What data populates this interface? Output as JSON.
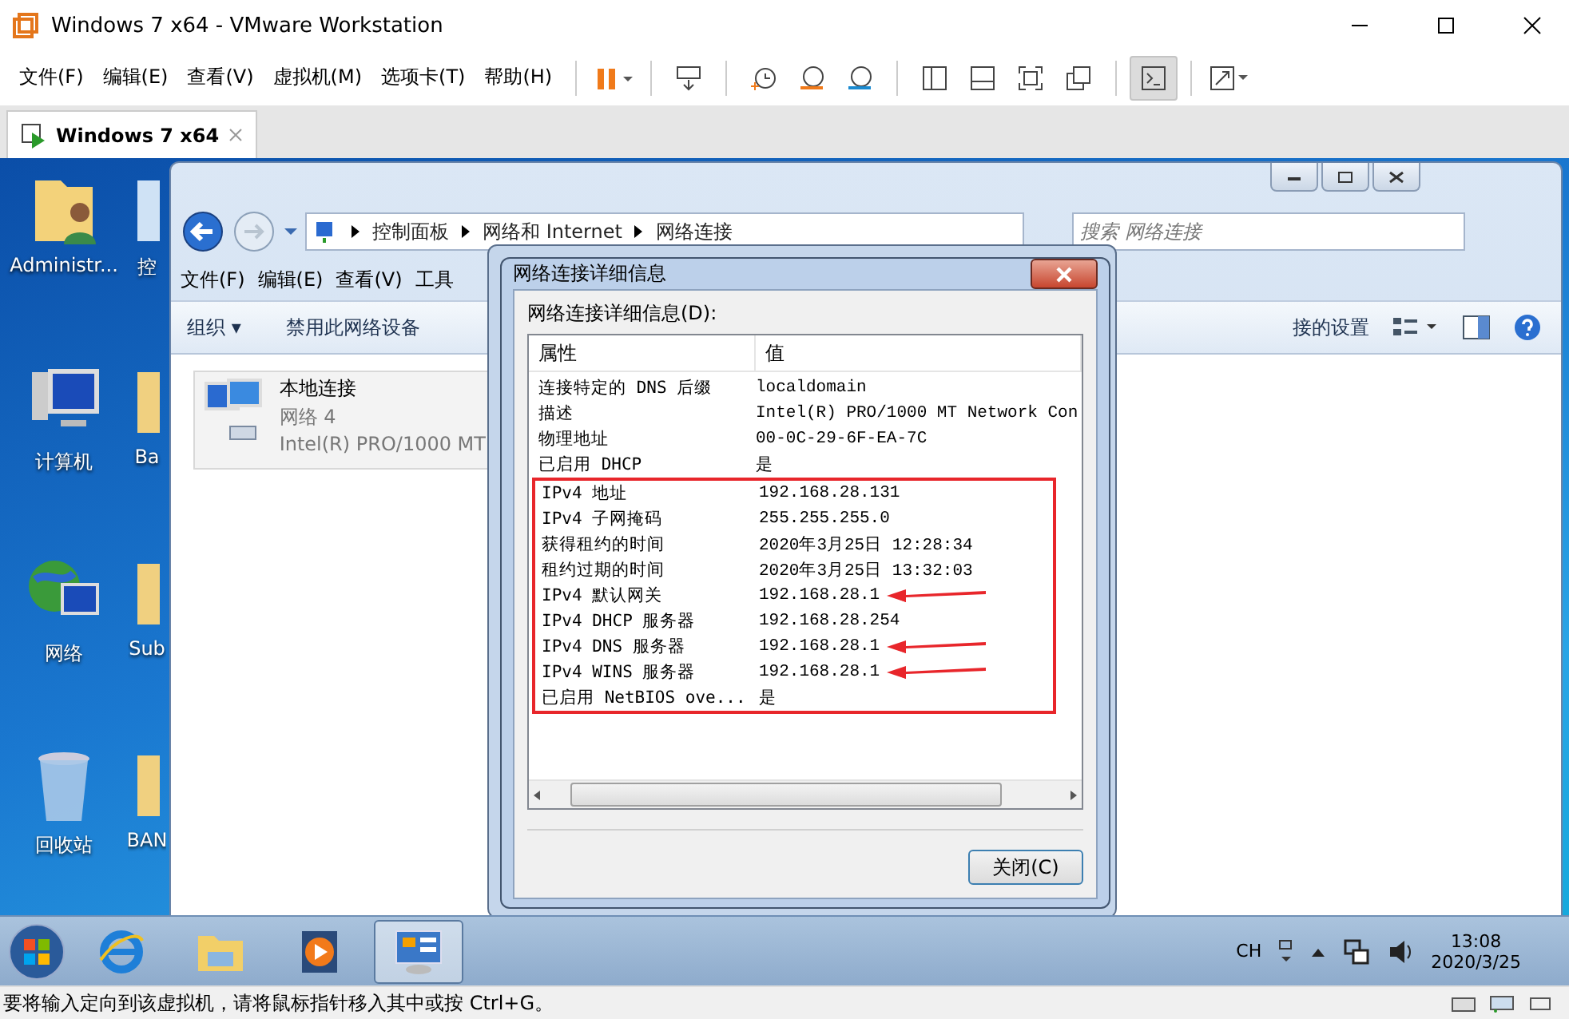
{
  "window": {
    "title": "Windows 7 x64 - VMware Workstation"
  },
  "menu": [
    "文件(F)",
    "编辑(E)",
    "查看(V)",
    "虚拟机(M)",
    "选项卡(T)",
    "帮助(H)"
  ],
  "tab": {
    "label": "Windows 7 x64",
    "selected": true
  },
  "desktop_icons": [
    {
      "kind": "user-folder",
      "label": "Administr..."
    },
    {
      "kind": "computer",
      "label": "计算机"
    },
    {
      "kind": "network",
      "label": "网络"
    },
    {
      "kind": "recycle-bin",
      "label": "回收站"
    }
  ],
  "desktop_icons_partial": [
    "控",
    "Ba",
    "Sub",
    "BAN"
  ],
  "explorer": {
    "breadcrumb": [
      "控制面板",
      "网络和 Internet",
      "网络连接"
    ],
    "search": {
      "placeholder": "搜索 网络连接"
    },
    "menu": [
      "文件(F)",
      "编辑(E)",
      "查看(V)",
      "工具"
    ],
    "commands": [
      "组织 ▾",
      "禁用此网络设备"
    ],
    "command_right": "接的设置",
    "item": {
      "name": "本地连接",
      "network": "网络  4",
      "adapter": "Intel(R) PRO/1000 MT"
    }
  },
  "dialog": {
    "title": "网络连接详细信息",
    "list_label": "网络连接详细信息(D):",
    "columns": [
      "属性",
      "值"
    ],
    "rows": [
      {
        "property": "连接特定的 DNS 后缀",
        "value": "localdomain"
      },
      {
        "property": "描述",
        "value": "Intel(R) PRO/1000 MT Network Con"
      },
      {
        "property": "物理地址",
        "value": "00-0C-29-6F-EA-7C"
      },
      {
        "property": "已启用 DHCP",
        "value": "是"
      }
    ],
    "highlighted_rows": [
      {
        "property": "IPv4 地址",
        "value": "192.168.28.131",
        "arrow": false
      },
      {
        "property": "IPv4 子网掩码",
        "value": "255.255.255.0",
        "arrow": false
      },
      {
        "property": "获得租约的时间",
        "value": "2020年3月25日 12:28:34",
        "arrow": false
      },
      {
        "property": "租约过期的时间",
        "value": "2020年3月25日 13:32:03",
        "arrow": false
      },
      {
        "property": "IPv4 默认网关",
        "value": "192.168.28.1",
        "arrow": true
      },
      {
        "property": "IPv4 DHCP 服务器",
        "value": "192.168.28.254",
        "arrow": false
      },
      {
        "property": "IPv4 DNS 服务器",
        "value": "192.168.28.1",
        "arrow": true
      },
      {
        "property": "IPv4 WINS 服务器",
        "value": "192.168.28.1",
        "arrow": true
      },
      {
        "property": "已启用 NetBIOS ove...",
        "value": "是",
        "arrow": false
      }
    ],
    "close_button": "关闭(C)"
  },
  "taskbar": {
    "apps": [
      {
        "kind": "ie",
        "selected": false
      },
      {
        "kind": "folder",
        "selected": false
      },
      {
        "kind": "media",
        "selected": false
      },
      {
        "kind": "control-panel",
        "selected": true
      }
    ],
    "language": "CH",
    "time": "13:08",
    "date": "2020/3/25"
  },
  "status_bar": {
    "message": "要将输入定向到该虚拟机，请将鼠标指针移入其中或按 Ctrl+G。"
  }
}
